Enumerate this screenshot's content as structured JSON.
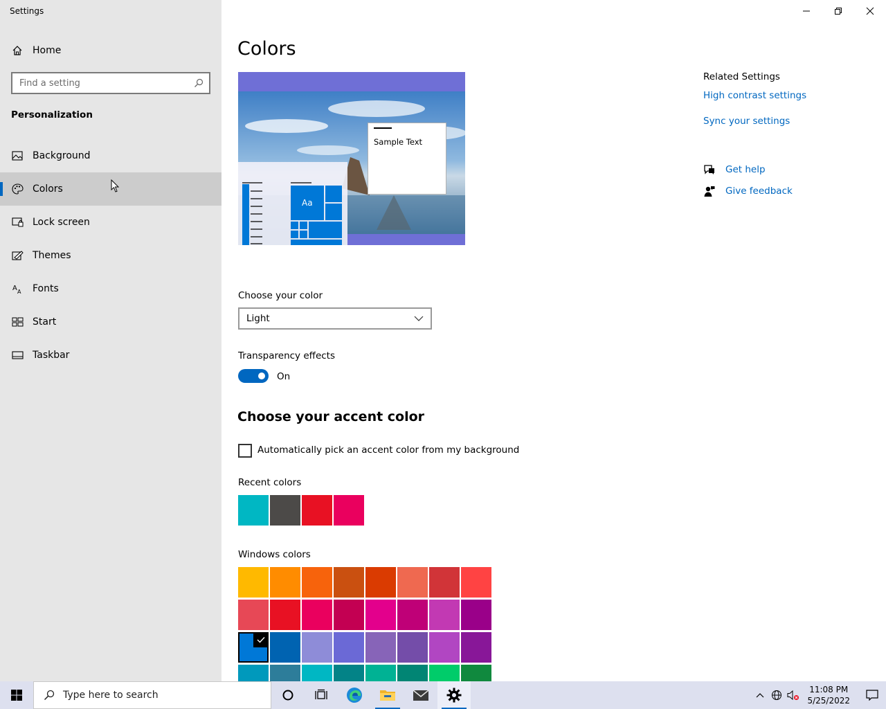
{
  "window": {
    "title": "Settings"
  },
  "sidebar": {
    "home_label": "Home",
    "search_placeholder": "Find a setting",
    "section": "Personalization",
    "items": [
      {
        "label": "Background",
        "icon": "picture-icon"
      },
      {
        "label": "Colors",
        "icon": "palette-icon",
        "active": true
      },
      {
        "label": "Lock screen",
        "icon": "lock-screen-icon"
      },
      {
        "label": "Themes",
        "icon": "themes-icon"
      },
      {
        "label": "Fonts",
        "icon": "fonts-icon"
      },
      {
        "label": "Start",
        "icon": "start-icon"
      },
      {
        "label": "Taskbar",
        "icon": "taskbar-icon"
      }
    ]
  },
  "main": {
    "title": "Colors",
    "preview": {
      "sample_text": "Sample Text",
      "tile_text": "Aa"
    },
    "choose_color": {
      "label": "Choose your color",
      "selected": "Light"
    },
    "transparency": {
      "label": "Transparency effects",
      "state": "On"
    },
    "accent": {
      "heading": "Choose your accent color",
      "auto_pick_label": "Automatically pick an accent color from my background",
      "recent_label": "Recent colors",
      "recent_colors": [
        "#00b7c3",
        "#4c4a48",
        "#e81123",
        "#ea005e"
      ],
      "windows_label": "Windows colors",
      "windows_colors": [
        [
          "#ffb900",
          "#ff8c00",
          "#f7630c",
          "#ca5010",
          "#da3b01",
          "#ef6950",
          "#d13438",
          "#ff4343"
        ],
        [
          "#e74856",
          "#e81123",
          "#ea005e",
          "#c30052",
          "#e3008c",
          "#bf0077",
          "#c239b3",
          "#9a0089"
        ],
        [
          "#0078d7",
          "#0063b1",
          "#8e8cd8",
          "#6b69d6",
          "#8764b8",
          "#744da9",
          "#b146c2",
          "#881798"
        ],
        [
          "#0099bc",
          "#2d7d9a",
          "#00b7c3",
          "#038387",
          "#00b294",
          "#018574",
          "#00cc6a",
          "#10893e"
        ]
      ],
      "selected_color": "#0078d7"
    }
  },
  "related": {
    "heading": "Related Settings",
    "links": [
      "High contrast settings",
      "Sync your settings"
    ],
    "get_help": "Get help",
    "give_feedback": "Give feedback"
  },
  "taskbar": {
    "search_placeholder": "Type here to search",
    "time": "11:08 PM",
    "date": "5/25/2022"
  },
  "colors": {
    "accent": "#0067c0",
    "sidebar_bg": "#e6e6e6",
    "taskbar_bg": "#dde0ef"
  }
}
